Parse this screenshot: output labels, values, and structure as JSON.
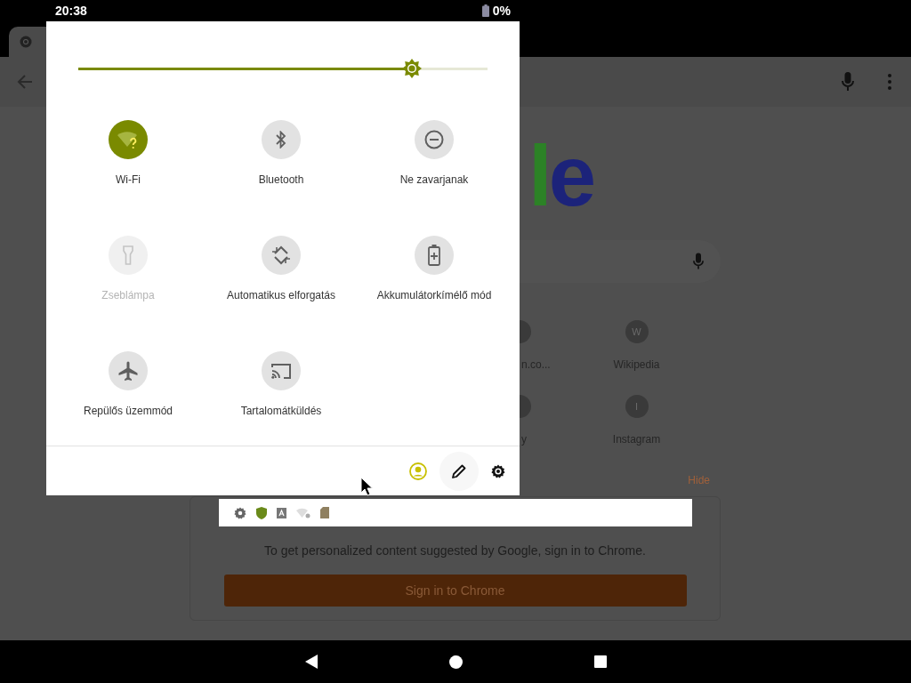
{
  "status_bar": {
    "time": "20:38",
    "battery": "0%"
  },
  "browser": {
    "logo": [
      {
        "text": "l",
        "color": "#2c8226"
      },
      {
        "text": "e",
        "color": "#1c237a"
      }
    ],
    "shortcuts": [
      {
        "kind": "cut",
        "label": "n.co..."
      },
      {
        "kind": "full",
        "letter": "W",
        "label": "Wikipedia"
      },
      {
        "kind": "cut",
        "label": "y"
      },
      {
        "kind": "full",
        "letter": "I",
        "label": "Instagram"
      }
    ],
    "hide_link": "Hide",
    "signin": {
      "text": "To get personalized content suggested by Google, sign in to Chrome.",
      "button": "Sign in to Chrome"
    }
  },
  "quick_settings": {
    "brightness": {
      "level": 0.815
    },
    "tiles": [
      {
        "kind": "wifi",
        "label": "Wi-Fi",
        "on": true,
        "disabled": false
      },
      {
        "kind": "bluetooth",
        "label": "Bluetooth",
        "on": false,
        "disabled": false
      },
      {
        "kind": "dnd",
        "label": "Ne zavarjanak",
        "on": false,
        "disabled": false
      },
      {
        "kind": "flashlight",
        "label": "Zseblámpa",
        "on": false,
        "disabled": true
      },
      {
        "kind": "rotate",
        "label": "Automatikus elforgatás",
        "on": false,
        "disabled": false
      },
      {
        "kind": "battery",
        "label": "Akkumulátorkímélő mód",
        "on": false,
        "disabled": false
      },
      {
        "kind": "airplane",
        "label": "Repülős üzemmód",
        "on": false,
        "disabled": false
      },
      {
        "kind": "cast",
        "label": "Tartalomátküldés",
        "on": false,
        "disabled": false
      }
    ]
  }
}
